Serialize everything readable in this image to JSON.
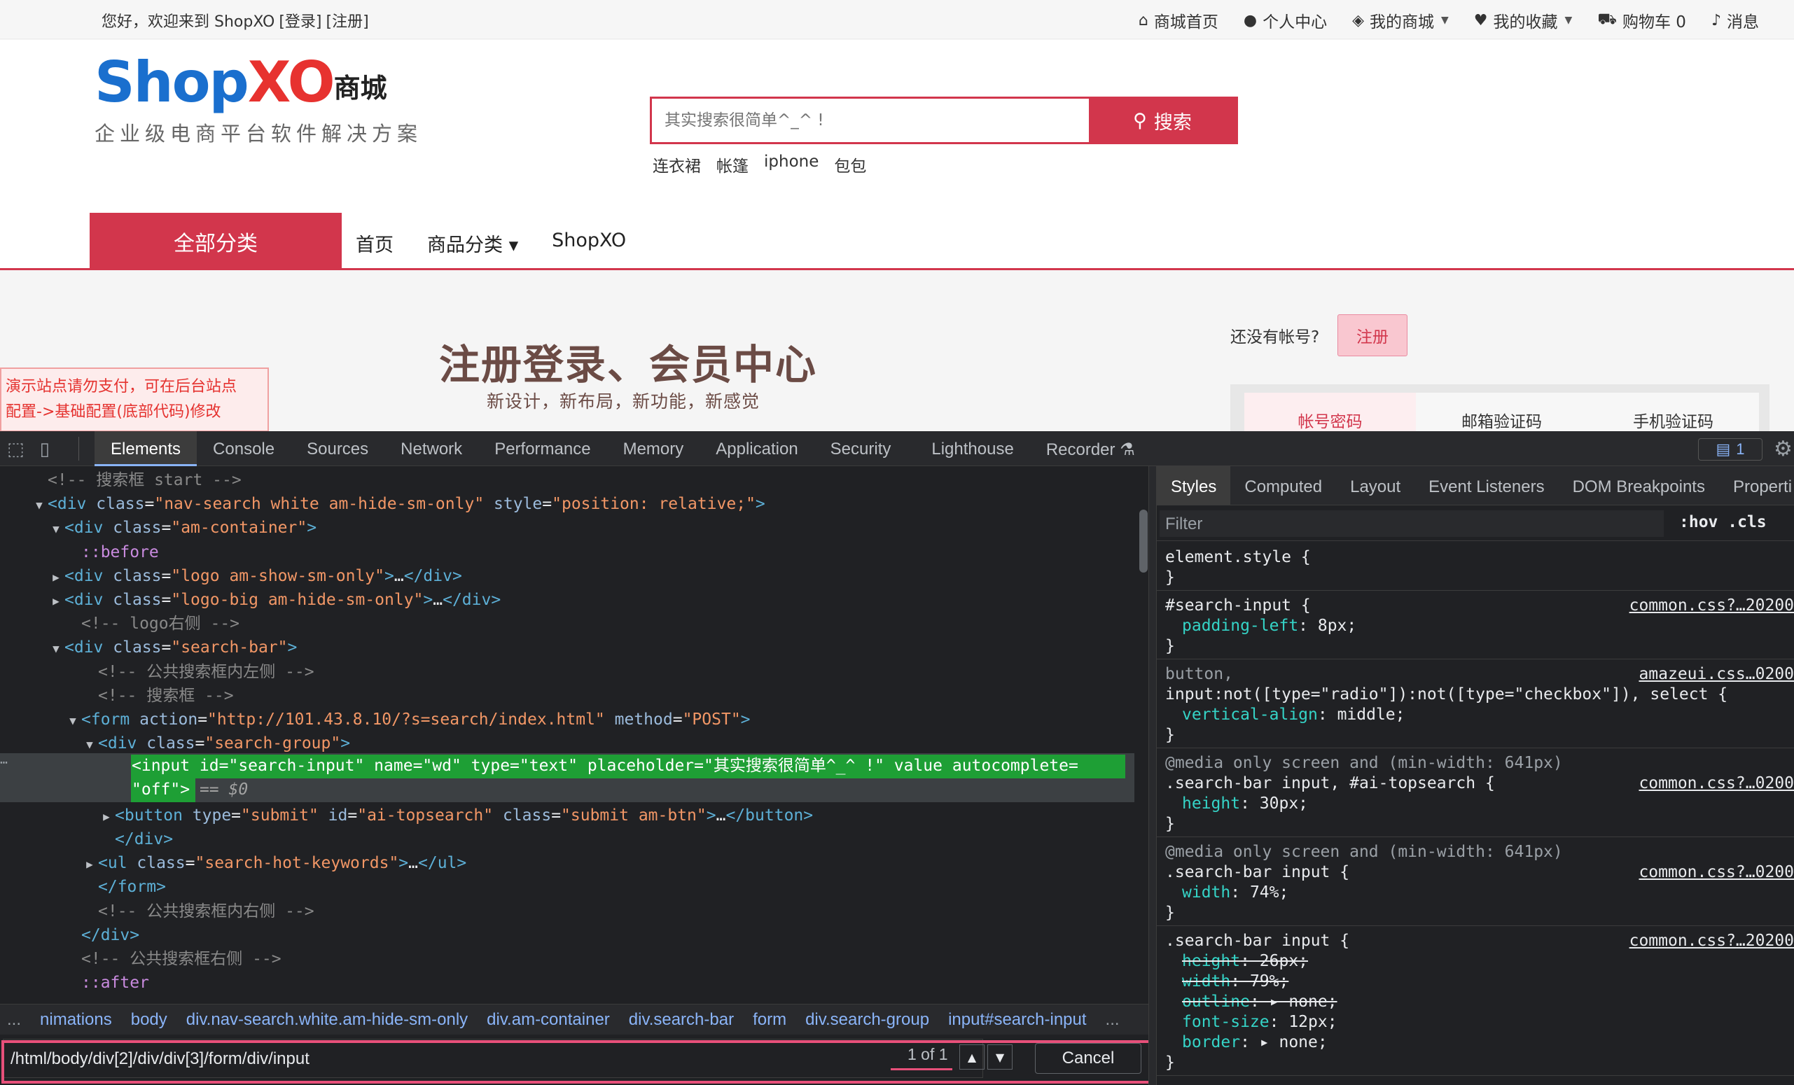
{
  "site": {
    "topbar": {
      "welcome": "您好，欢迎来到 ShopXO",
      "login": "[登录]",
      "register": "[注册]",
      "nav": [
        {
          "icon": "home-icon",
          "glyph": "⌂",
          "label": "商城首页",
          "dropdown": false
        },
        {
          "icon": "user-icon",
          "glyph": "●",
          "label": "个人中心",
          "dropdown": false
        },
        {
          "icon": "cube-icon",
          "glyph": "◈",
          "label": "我的商城",
          "dropdown": true
        },
        {
          "icon": "heart-icon",
          "glyph": "♥",
          "label": "我的收藏",
          "dropdown": true
        },
        {
          "icon": "cart-icon",
          "glyph": "⛟",
          "label": "购物车 0",
          "dropdown": false
        },
        {
          "icon": "bell-icon",
          "glyph": "♪",
          "label": "消息",
          "dropdown": false
        }
      ]
    },
    "logo": {
      "shop": "Shop",
      "xo": "XO",
      "cn": "商城",
      "tagline": "企业级电商平台软件解决方案"
    },
    "search": {
      "placeholder": "其实搜索很简单^_^ !",
      "button": "搜索"
    },
    "hot_keywords": [
      "连衣裙",
      "帐篷",
      "iphone",
      "包包"
    ],
    "navbar": {
      "all_categories": "全部分类",
      "links": [
        "首页",
        "商品分类",
        "ShopXO"
      ]
    },
    "hero": {
      "slogan": "注册登录、会员中心",
      "sub": "新设计，新布局，新功能，新感觉",
      "no_account": "还没有帐号?",
      "register_btn": "注册",
      "login_tabs": [
        "帐号密码",
        "邮箱验证码",
        "手机验证码"
      ]
    },
    "notice": [
      "演示站点请勿支付，可在后台站点",
      "配置->基础配置(底部代码)修改"
    ]
  },
  "devtools": {
    "tabs": [
      "Elements",
      "Console",
      "Sources",
      "Network",
      "Performance",
      "Memory",
      "Application",
      "Security",
      "Lighthouse",
      "Recorder"
    ],
    "active_tab": "Elements",
    "messages_count": "1",
    "dom_lines": [
      {
        "indent": 1,
        "tw": "",
        "parts": [
          [
            "com",
            "<!-- 搜索框 start -->"
          ]
        ]
      },
      {
        "indent": 1,
        "tw": "▼",
        "parts": [
          [
            "tag",
            "<div "
          ],
          [
            "attr",
            "class"
          ],
          [
            "eq",
            "="
          ],
          [
            "val",
            "\"nav-search white am-hide-sm-only\""
          ],
          [
            "attr",
            " style"
          ],
          [
            "eq",
            "="
          ],
          [
            "val",
            "\"position: relative;\""
          ],
          [
            "tag",
            ">"
          ]
        ]
      },
      {
        "indent": 2,
        "tw": "▼",
        "parts": [
          [
            "tag",
            "<div "
          ],
          [
            "attr",
            "class"
          ],
          [
            "eq",
            "="
          ],
          [
            "val",
            "\"am-container\""
          ],
          [
            "tag",
            ">"
          ]
        ]
      },
      {
        "indent": 3,
        "tw": "",
        "parts": [
          [
            "pseudo",
            "::before"
          ]
        ]
      },
      {
        "indent": 2,
        "tw": "▶",
        "parts": [
          [
            "tag",
            "<div "
          ],
          [
            "attr",
            "class"
          ],
          [
            "eq",
            "="
          ],
          [
            "val",
            "\"logo am-show-sm-only\""
          ],
          [
            "tag",
            ">"
          ],
          [
            "txt",
            "…"
          ],
          [
            "tag",
            "</div>"
          ]
        ]
      },
      {
        "indent": 2,
        "tw": "▶",
        "parts": [
          [
            "tag",
            "<div "
          ],
          [
            "attr",
            "class"
          ],
          [
            "eq",
            "="
          ],
          [
            "val",
            "\"logo-big am-hide-sm-only\""
          ],
          [
            "tag",
            ">"
          ],
          [
            "txt",
            "…"
          ],
          [
            "tag",
            "</div>"
          ]
        ]
      },
      {
        "indent": 3,
        "tw": "",
        "parts": [
          [
            "com",
            "<!-- logo右侧 -->"
          ]
        ]
      },
      {
        "indent": 2,
        "tw": "▼",
        "parts": [
          [
            "tag",
            "<div "
          ],
          [
            "attr",
            "class"
          ],
          [
            "eq",
            "="
          ],
          [
            "val",
            "\"search-bar\""
          ],
          [
            "tag",
            ">"
          ]
        ]
      },
      {
        "indent": 4,
        "tw": "",
        "parts": [
          [
            "com",
            "<!-- 公共搜索框内左侧 -->"
          ]
        ]
      },
      {
        "indent": 4,
        "tw": "",
        "parts": [
          [
            "com",
            "<!-- 搜索框 -->"
          ]
        ]
      },
      {
        "indent": 3,
        "tw": "▼",
        "parts": [
          [
            "tag",
            "<form "
          ],
          [
            "attr",
            "action"
          ],
          [
            "eq",
            "="
          ],
          [
            "val",
            "\"http://101.43.8.10/?s=search/index.html\""
          ],
          [
            "attr",
            " method"
          ],
          [
            "eq",
            "="
          ],
          [
            "val",
            "\"POST\""
          ],
          [
            "tag",
            ">"
          ]
        ]
      },
      {
        "indent": 4,
        "tw": "▼",
        "parts": [
          [
            "tag",
            "<div "
          ],
          [
            "attr",
            "class"
          ],
          [
            "eq",
            "="
          ],
          [
            "val",
            "\"search-group\""
          ],
          [
            "tag",
            ">"
          ]
        ]
      },
      {
        "indent": 0,
        "tw": "",
        "selected": true,
        "parts": []
      },
      {
        "indent": 0,
        "tw": "",
        "skip": true,
        "parts": []
      },
      {
        "indent": 5,
        "tw": "▶",
        "parts": [
          [
            "tag",
            "<button "
          ],
          [
            "attr",
            "type"
          ],
          [
            "eq",
            "="
          ],
          [
            "val",
            "\"submit\""
          ],
          [
            "attr",
            " id"
          ],
          [
            "eq",
            "="
          ],
          [
            "val",
            "\"ai-topsearch\""
          ],
          [
            "attr",
            " class"
          ],
          [
            "eq",
            "="
          ],
          [
            "val",
            "\"submit am-btn\""
          ],
          [
            "tag",
            ">"
          ],
          [
            "txt",
            "…"
          ],
          [
            "tag",
            "</button>"
          ]
        ]
      },
      {
        "indent": 5,
        "tw": "",
        "parts": [
          [
            "tag",
            "</div>"
          ]
        ]
      },
      {
        "indent": 4,
        "tw": "▶",
        "parts": [
          [
            "tag",
            "<ul "
          ],
          [
            "attr",
            "class"
          ],
          [
            "eq",
            "="
          ],
          [
            "val",
            "\"search-hot-keywords\""
          ],
          [
            "tag",
            ">"
          ],
          [
            "txt",
            "…"
          ],
          [
            "tag",
            "</ul>"
          ]
        ]
      },
      {
        "indent": 4,
        "tw": "",
        "parts": [
          [
            "tag",
            "</form>"
          ]
        ]
      },
      {
        "indent": 4,
        "tw": "",
        "parts": [
          [
            "com",
            "<!-- 公共搜索框内右侧 -->"
          ]
        ]
      },
      {
        "indent": 3,
        "tw": "",
        "parts": [
          [
            "tag",
            "</div>"
          ]
        ]
      },
      {
        "indent": 3,
        "tw": "",
        "parts": [
          [
            "com",
            "<!-- 公共搜索框右侧 -->"
          ]
        ]
      },
      {
        "indent": 3,
        "tw": "",
        "parts": [
          [
            "pseudo",
            "::after"
          ]
        ]
      }
    ],
    "selected_node": {
      "line1": "<input id=\"search-input\" name=\"wd\" type=\"text\" placeholder=\"其实搜索很简单^_^ !\" value autocomplete=",
      "line2": "\"off\">",
      "eq": " == $0"
    },
    "breadcrumbs": [
      "...",
      "nimations",
      "body",
      "div.nav-search.white.am-hide-sm-only",
      "div.am-container",
      "div.search-bar",
      "form",
      "div.search-group",
      "input#search-input",
      "..."
    ],
    "search": {
      "query": "/html/body/div[2]/div/div[3]/form/div/input",
      "count": "1 of 1",
      "cancel": "Cancel"
    },
    "styles": {
      "tabs": [
        "Styles",
        "Computed",
        "Layout",
        "Event Listeners",
        "DOM Breakpoints",
        "Properti"
      ],
      "filter_placeholder": "Filter",
      "hov": ":hov",
      "cls": ".cls",
      "rules": [
        {
          "selector": "element.style {",
          "source": "",
          "props": [],
          "close": "}"
        },
        {
          "selector": "#search-input {",
          "source": "common.css?…20200",
          "props": [
            {
              "p": "padding-left",
              "v": "8px;"
            }
          ],
          "close": "}"
        },
        {
          "selector": "button,",
          "selector2": "input:not([type=\"radio\"]):not([type=\"checkbox\"]), select {",
          "source": "amazeui.css…0200",
          "props": [
            {
              "p": "vertical-align",
              "v": "middle;"
            }
          ],
          "close": "}"
        },
        {
          "media": "@media only screen and (min-width: 641px)",
          "selector": ".search-bar input, #ai-topsearch {",
          "source": "common.css?…0200",
          "props": [
            {
              "p": "height",
              "v": "30px;"
            }
          ],
          "close": "}"
        },
        {
          "media": "@media only screen and (min-width: 641px)",
          "selector": ".search-bar input {",
          "source": "common.css?…0200",
          "props": [
            {
              "p": "width",
              "v": "74%;"
            }
          ],
          "close": "}"
        },
        {
          "selector": ".search-bar input {",
          "source": "common.css?…20200",
          "props": [
            {
              "p": "height",
              "v": "26px;",
              "strike": true
            },
            {
              "p": "width",
              "v": "79%;",
              "strike": true
            },
            {
              "p": "outline",
              "v": "▸ none;",
              "strike": true
            },
            {
              "p": "font-size",
              "v": "12px;"
            },
            {
              "p": "border",
              "v": "▸ none;"
            }
          ],
          "close": "}"
        }
      ]
    }
  }
}
